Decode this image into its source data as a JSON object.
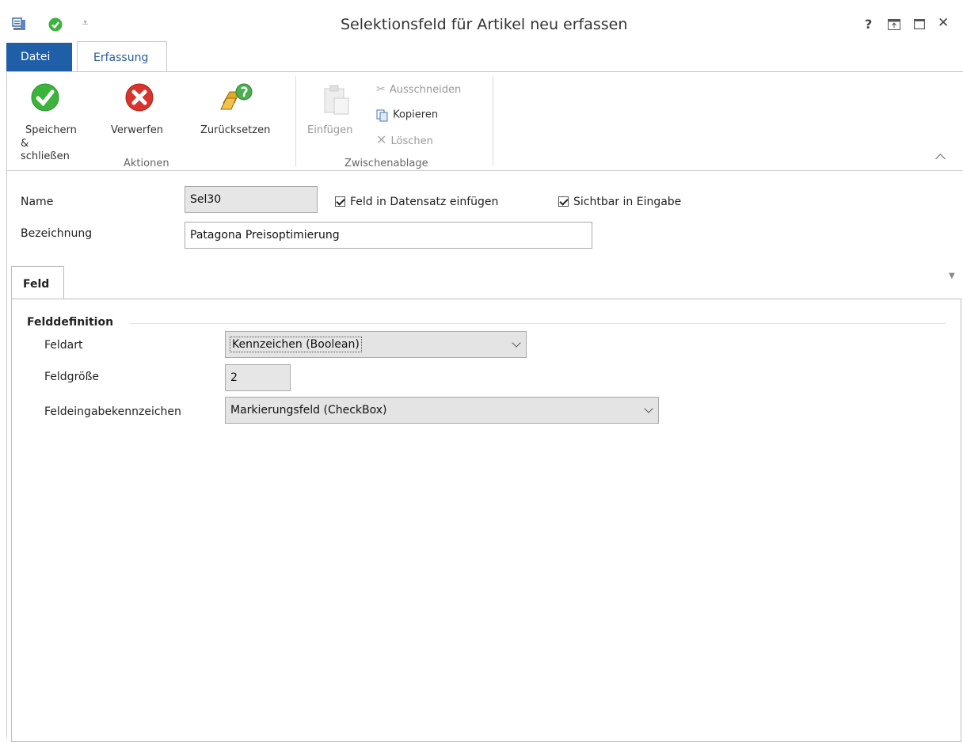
{
  "window": {
    "title": "Selektionsfeld für Artikel neu erfassen",
    "help": "?",
    "restore": "⧉",
    "maximize": "☐",
    "close": "✕"
  },
  "ribbon_tabs": {
    "file": "Datei",
    "active": "Erfassung"
  },
  "ribbon": {
    "save_close_line1": "Speichern",
    "save_close_line2": "& schließen",
    "discard": "Verwerfen",
    "reset": "Zurücksetzen",
    "group_actions": "Aktionen",
    "paste": "Einfügen",
    "cut": "Ausschneiden",
    "copy": "Kopieren",
    "delete": "Löschen",
    "group_clipboard": "Zwischenablage"
  },
  "form": {
    "name_label": "Name",
    "name_value": "Sel30",
    "insert_checkbox": "Feld in Datensatz einfügen",
    "insert_checked": true,
    "visible_checkbox": "Sichtbar in Eingabe",
    "visible_checked": true,
    "designation_label": "Bezeichnung",
    "designation_value": "Patagona Preisoptimierung"
  },
  "tabs": {
    "feld": "Feld"
  },
  "felddefinition": {
    "section_title": "Felddefinition",
    "feldart_label": "Feldart",
    "feldart_value": "Kennzeichen (Boolean)",
    "feldgroesse_label": "Feldgröße",
    "feldgroesse_value": "2",
    "eingabe_label": "Feldeingabekennzeichen",
    "eingabe_value": "Markierungsfeld (CheckBox)"
  },
  "colors": {
    "accent": "#1f5fa8",
    "save_green": "#3cb43c",
    "discard_red": "#d9342b"
  },
  "icons": [
    "app-icon",
    "checkmark-icon",
    "quick-access-dropdown-icon",
    "save-check-icon",
    "discard-x-icon",
    "reset-icon",
    "paste-icon",
    "cut-icon",
    "copy-icon",
    "delete-icon",
    "collapse-ribbon-icon"
  ]
}
